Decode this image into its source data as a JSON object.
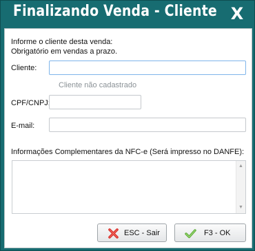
{
  "window": {
    "title": "Finalizando Venda - Cliente",
    "close_label": "X"
  },
  "form": {
    "intro_line1": "Informe o cliente desta venda:",
    "intro_line2": "Obrigatório em vendas a prazo.",
    "cliente_label": "Cliente:",
    "cliente_value": "",
    "cliente_status": "Cliente não cadastrado",
    "cpf_label": "CPF/CNPJ:",
    "cpf_value": "",
    "email_label": "E-mail:",
    "email_value": "",
    "info_label": "Informações Complementares da NFC-e (Será impresso no DANFE):",
    "info_value": ""
  },
  "buttons": {
    "cancel_label": "ESC - Sair",
    "ok_label": "F3 - OK"
  },
  "colors": {
    "titlebar": "#176c71",
    "focus_border": "#7eb4ea",
    "cancel_icon": "#d9302b",
    "ok_icon": "#5fae3a"
  },
  "icons": {
    "close": "close-icon",
    "cancel": "red-x-icon",
    "ok": "green-check-icon"
  }
}
